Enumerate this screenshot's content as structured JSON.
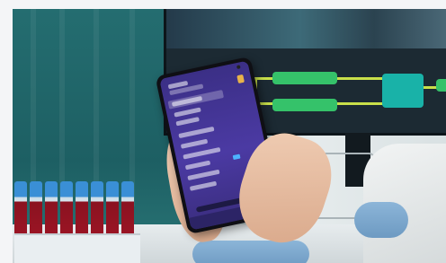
{
  "scene": {
    "description_colors": {
      "lab_teal": "#1f6f73",
      "monitor_dark": "#1c2a33",
      "node_green": "#35c26a",
      "node_teal": "#19b2a8",
      "wire_yellow": "#c9e04a",
      "tube_cap_blue": "#3a8fd6",
      "tube_blood_red": "#a31626",
      "phone_screen_purple": "#4b3aa3"
    },
    "tube_count": 8
  }
}
